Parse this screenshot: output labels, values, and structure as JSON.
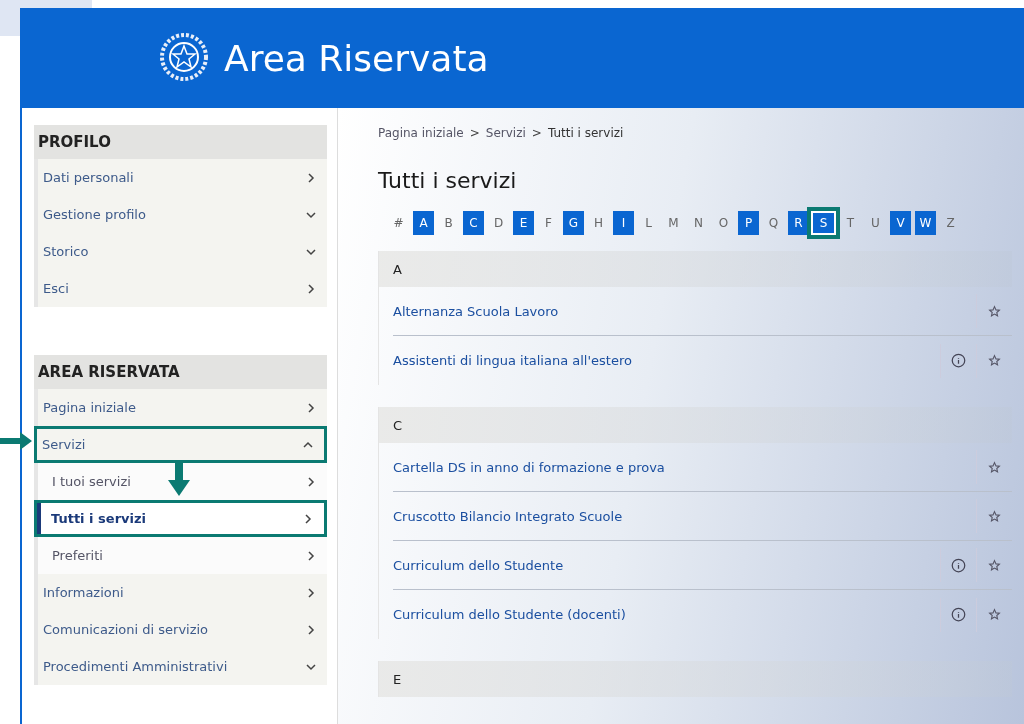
{
  "header": {
    "title": "Area Riservata"
  },
  "sidebar": {
    "sections": [
      {
        "title": "PROFILO",
        "items": [
          {
            "label": "Dati personali",
            "selected": false,
            "highlighted": false
          },
          {
            "label": "Gestione profilo",
            "expanded": false,
            "selected": false,
            "highlighted": false
          },
          {
            "label": "Storico",
            "expanded": false,
            "selected": false,
            "highlighted": false
          },
          {
            "label": "Esci",
            "selected": false,
            "highlighted": false
          }
        ]
      },
      {
        "title": "AREA RISERVATA",
        "items": [
          {
            "label": "Pagina iniziale",
            "selected": false,
            "highlighted": false
          },
          {
            "label": "Servizi",
            "expanded": true,
            "selected": false,
            "highlighted": true,
            "children": [
              {
                "label": "I tuoi servizi",
                "selected": false,
                "highlighted": false
              },
              {
                "label": "Tutti i servizi",
                "selected": true,
                "highlighted": true
              },
              {
                "label": "Preferiti",
                "selected": false,
                "highlighted": false
              }
            ]
          },
          {
            "label": "Informazioni",
            "selected": false,
            "highlighted": false
          },
          {
            "label": "Comunicazioni di servizio",
            "selected": false,
            "highlighted": false
          },
          {
            "label": "Procedimenti Amministrativi",
            "expanded": false,
            "selected": false,
            "highlighted": false
          }
        ]
      }
    ]
  },
  "breadcrumb": [
    "Pagina iniziale",
    "Servizi",
    "Tutti i servizi"
  ],
  "breadcrumb_separator": ">",
  "page_title": "Tutti i servizi",
  "letters": [
    {
      "label": "#",
      "available": false,
      "highlighted": false
    },
    {
      "label": "A",
      "available": true,
      "highlighted": false
    },
    {
      "label": "B",
      "available": false,
      "highlighted": false
    },
    {
      "label": "C",
      "available": true,
      "highlighted": false
    },
    {
      "label": "D",
      "available": false,
      "highlighted": false
    },
    {
      "label": "E",
      "available": true,
      "highlighted": false
    },
    {
      "label": "F",
      "available": false,
      "highlighted": false
    },
    {
      "label": "G",
      "available": true,
      "highlighted": false
    },
    {
      "label": "H",
      "available": false,
      "highlighted": false
    },
    {
      "label": "I",
      "available": true,
      "highlighted": false
    },
    {
      "label": "L",
      "available": false,
      "highlighted": false
    },
    {
      "label": "M",
      "available": false,
      "highlighted": false
    },
    {
      "label": "N",
      "available": false,
      "highlighted": false
    },
    {
      "label": "O",
      "available": false,
      "highlighted": false
    },
    {
      "label": "P",
      "available": true,
      "highlighted": false
    },
    {
      "label": "Q",
      "available": false,
      "highlighted": false
    },
    {
      "label": "R",
      "available": true,
      "highlighted": false
    },
    {
      "label": "S",
      "available": true,
      "highlighted": true
    },
    {
      "label": "T",
      "available": false,
      "highlighted": false
    },
    {
      "label": "U",
      "available": false,
      "highlighted": false
    },
    {
      "label": "V",
      "available": true,
      "highlighted": false
    },
    {
      "label": "W",
      "available": true,
      "highlighted": false
    },
    {
      "label": "Z",
      "available": false,
      "highlighted": false
    }
  ],
  "groups": [
    {
      "letter": "A",
      "services": [
        {
          "name": "Alternanza Scuola Lavoro",
          "info": false
        },
        {
          "name": "Assistenti di lingua italiana all'estero",
          "info": true
        }
      ]
    },
    {
      "letter": "C",
      "services": [
        {
          "name": "Cartella DS in anno di formazione e prova",
          "info": false
        },
        {
          "name": "Cruscotto Bilancio Integrato Scuole",
          "info": false
        },
        {
          "name": "Curriculum dello Studente",
          "info": true
        },
        {
          "name": "Curriculum dello Studente (docenti)",
          "info": true
        }
      ]
    },
    {
      "letter": "E"
    }
  ]
}
